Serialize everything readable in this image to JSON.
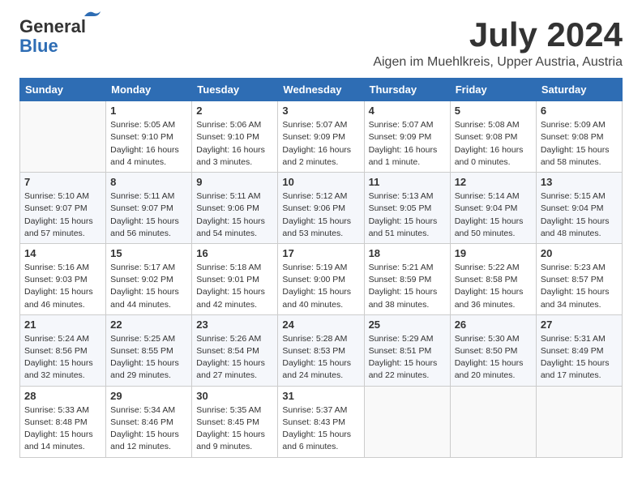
{
  "header": {
    "logo_line1": "General",
    "logo_line2": "Blue",
    "month": "July 2024",
    "location": "Aigen im Muehlkreis, Upper Austria, Austria"
  },
  "weekdays": [
    "Sunday",
    "Monday",
    "Tuesday",
    "Wednesday",
    "Thursday",
    "Friday",
    "Saturday"
  ],
  "weeks": [
    [
      {
        "day": "",
        "info": ""
      },
      {
        "day": "1",
        "info": "Sunrise: 5:05 AM\nSunset: 9:10 PM\nDaylight: 16 hours\nand 4 minutes."
      },
      {
        "day": "2",
        "info": "Sunrise: 5:06 AM\nSunset: 9:10 PM\nDaylight: 16 hours\nand 3 minutes."
      },
      {
        "day": "3",
        "info": "Sunrise: 5:07 AM\nSunset: 9:09 PM\nDaylight: 16 hours\nand 2 minutes."
      },
      {
        "day": "4",
        "info": "Sunrise: 5:07 AM\nSunset: 9:09 PM\nDaylight: 16 hours\nand 1 minute."
      },
      {
        "day": "5",
        "info": "Sunrise: 5:08 AM\nSunset: 9:08 PM\nDaylight: 16 hours\nand 0 minutes."
      },
      {
        "day": "6",
        "info": "Sunrise: 5:09 AM\nSunset: 9:08 PM\nDaylight: 15 hours\nand 58 minutes."
      }
    ],
    [
      {
        "day": "7",
        "info": "Sunrise: 5:10 AM\nSunset: 9:07 PM\nDaylight: 15 hours\nand 57 minutes."
      },
      {
        "day": "8",
        "info": "Sunrise: 5:11 AM\nSunset: 9:07 PM\nDaylight: 15 hours\nand 56 minutes."
      },
      {
        "day": "9",
        "info": "Sunrise: 5:11 AM\nSunset: 9:06 PM\nDaylight: 15 hours\nand 54 minutes."
      },
      {
        "day": "10",
        "info": "Sunrise: 5:12 AM\nSunset: 9:06 PM\nDaylight: 15 hours\nand 53 minutes."
      },
      {
        "day": "11",
        "info": "Sunrise: 5:13 AM\nSunset: 9:05 PM\nDaylight: 15 hours\nand 51 minutes."
      },
      {
        "day": "12",
        "info": "Sunrise: 5:14 AM\nSunset: 9:04 PM\nDaylight: 15 hours\nand 50 minutes."
      },
      {
        "day": "13",
        "info": "Sunrise: 5:15 AM\nSunset: 9:04 PM\nDaylight: 15 hours\nand 48 minutes."
      }
    ],
    [
      {
        "day": "14",
        "info": "Sunrise: 5:16 AM\nSunset: 9:03 PM\nDaylight: 15 hours\nand 46 minutes."
      },
      {
        "day": "15",
        "info": "Sunrise: 5:17 AM\nSunset: 9:02 PM\nDaylight: 15 hours\nand 44 minutes."
      },
      {
        "day": "16",
        "info": "Sunrise: 5:18 AM\nSunset: 9:01 PM\nDaylight: 15 hours\nand 42 minutes."
      },
      {
        "day": "17",
        "info": "Sunrise: 5:19 AM\nSunset: 9:00 PM\nDaylight: 15 hours\nand 40 minutes."
      },
      {
        "day": "18",
        "info": "Sunrise: 5:21 AM\nSunset: 8:59 PM\nDaylight: 15 hours\nand 38 minutes."
      },
      {
        "day": "19",
        "info": "Sunrise: 5:22 AM\nSunset: 8:58 PM\nDaylight: 15 hours\nand 36 minutes."
      },
      {
        "day": "20",
        "info": "Sunrise: 5:23 AM\nSunset: 8:57 PM\nDaylight: 15 hours\nand 34 minutes."
      }
    ],
    [
      {
        "day": "21",
        "info": "Sunrise: 5:24 AM\nSunset: 8:56 PM\nDaylight: 15 hours\nand 32 minutes."
      },
      {
        "day": "22",
        "info": "Sunrise: 5:25 AM\nSunset: 8:55 PM\nDaylight: 15 hours\nand 29 minutes."
      },
      {
        "day": "23",
        "info": "Sunrise: 5:26 AM\nSunset: 8:54 PM\nDaylight: 15 hours\nand 27 minutes."
      },
      {
        "day": "24",
        "info": "Sunrise: 5:28 AM\nSunset: 8:53 PM\nDaylight: 15 hours\nand 24 minutes."
      },
      {
        "day": "25",
        "info": "Sunrise: 5:29 AM\nSunset: 8:51 PM\nDaylight: 15 hours\nand 22 minutes."
      },
      {
        "day": "26",
        "info": "Sunrise: 5:30 AM\nSunset: 8:50 PM\nDaylight: 15 hours\nand 20 minutes."
      },
      {
        "day": "27",
        "info": "Sunrise: 5:31 AM\nSunset: 8:49 PM\nDaylight: 15 hours\nand 17 minutes."
      }
    ],
    [
      {
        "day": "28",
        "info": "Sunrise: 5:33 AM\nSunset: 8:48 PM\nDaylight: 15 hours\nand 14 minutes."
      },
      {
        "day": "29",
        "info": "Sunrise: 5:34 AM\nSunset: 8:46 PM\nDaylight: 15 hours\nand 12 minutes."
      },
      {
        "day": "30",
        "info": "Sunrise: 5:35 AM\nSunset: 8:45 PM\nDaylight: 15 hours\nand 9 minutes."
      },
      {
        "day": "31",
        "info": "Sunrise: 5:37 AM\nSunset: 8:43 PM\nDaylight: 15 hours\nand 6 minutes."
      },
      {
        "day": "",
        "info": ""
      },
      {
        "day": "",
        "info": ""
      },
      {
        "day": "",
        "info": ""
      }
    ]
  ]
}
